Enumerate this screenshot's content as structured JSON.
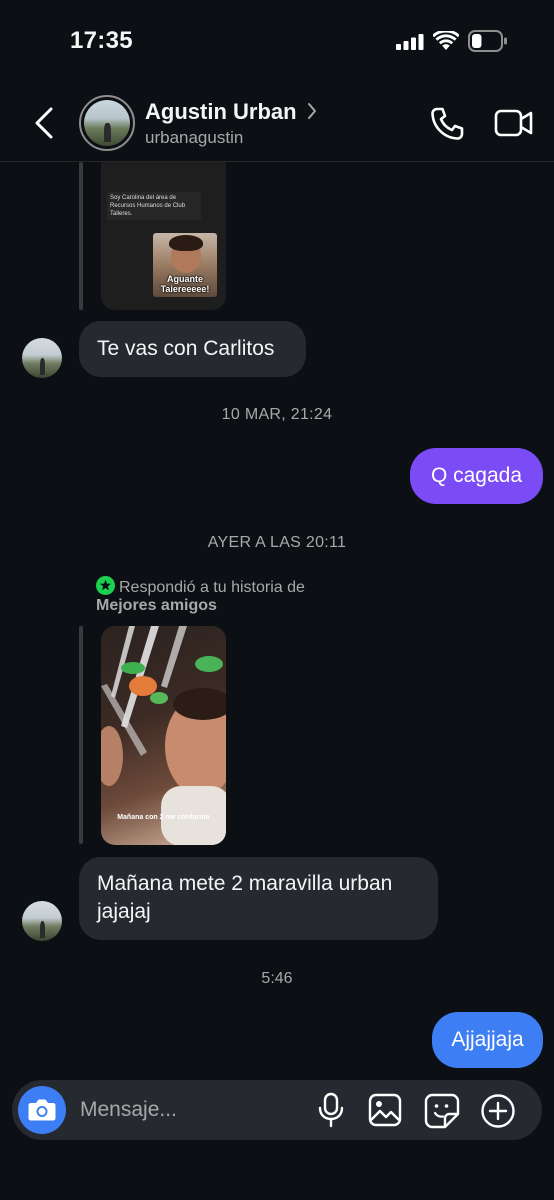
{
  "status_bar": {
    "time": "17:35"
  },
  "header": {
    "name": "Agustin Urban",
    "username": "urbanagustin"
  },
  "messages": [
    {
      "type": "story_reply",
      "direction": "incoming",
      "story": {
        "caption": "Soy Carolina del área de Recursos Humanos de Club Talleres.",
        "sticker_text": "Aguante Taiereeeee!"
      }
    },
    {
      "type": "text",
      "direction": "incoming",
      "text": "Te vas con Carlitos"
    },
    {
      "type": "timestamp",
      "text": "10 MAR, 21:24"
    },
    {
      "type": "text",
      "direction": "outgoing",
      "text": "Q cagada"
    },
    {
      "type": "timestamp",
      "text": "AYER A LAS 20:11"
    },
    {
      "type": "story_reply",
      "direction": "incoming",
      "note": "Respondió a tu historia de",
      "note_bold": "Mejores amigos",
      "story": {
        "caption": "Mañana con 2 me conformo"
      }
    },
    {
      "type": "text",
      "direction": "incoming",
      "text": "Mañana mete 2 maravilla urban jajajaj"
    },
    {
      "type": "timestamp",
      "text": "5:46"
    },
    {
      "type": "text",
      "direction": "outgoing",
      "text": "Ajjajjaja"
    }
  ],
  "composer": {
    "placeholder": "Mensaje..."
  },
  "colors": {
    "background": "#0c1014",
    "incoming_bubble": "#262a30",
    "outgoing_bubble_purple": "#7b4cf5",
    "outgoing_bubble_blue": "#3d7ef5",
    "close_friends_green": "#1cd14f"
  },
  "icons": [
    "signal-icon",
    "wifi-icon",
    "battery-icon",
    "back-icon",
    "chevron-right-icon",
    "phone-icon",
    "video-camera-icon",
    "star-icon",
    "camera-icon",
    "microphone-icon",
    "gallery-icon",
    "sticker-icon",
    "plus-icon"
  ],
  "status_indicators": {
    "battery_level": 0.35
  }
}
